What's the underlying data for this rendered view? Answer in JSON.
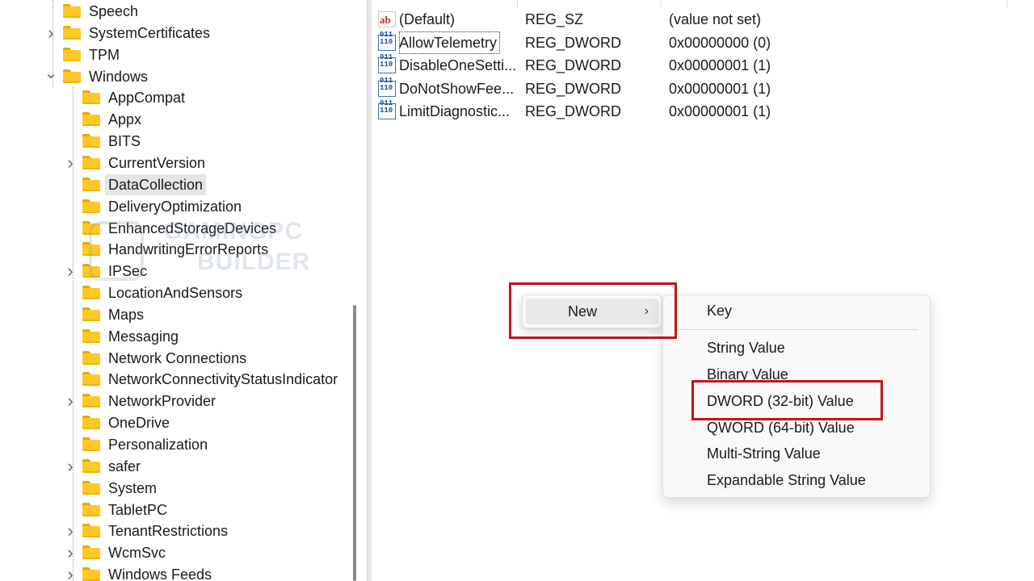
{
  "tree": {
    "nodes": [
      {
        "label": "Speech",
        "chevron": ""
      },
      {
        "label": "SystemCertificates",
        "chevron": "›"
      },
      {
        "label": "TPM",
        "chevron": ""
      },
      {
        "label": "Windows",
        "chevron": "⌄"
      },
      {
        "label": "AppCompat",
        "chevron": ""
      },
      {
        "label": "Appx",
        "chevron": ""
      },
      {
        "label": "BITS",
        "chevron": ""
      },
      {
        "label": "CurrentVersion",
        "chevron": "›"
      },
      {
        "label": "DataCollection",
        "chevron": "",
        "selected": true
      },
      {
        "label": "DeliveryOptimization",
        "chevron": ""
      },
      {
        "label": "EnhancedStorageDevices",
        "chevron": ""
      },
      {
        "label": "HandwritingErrorReports",
        "chevron": ""
      },
      {
        "label": "IPSec",
        "chevron": "›"
      },
      {
        "label": "LocationAndSensors",
        "chevron": ""
      },
      {
        "label": "Maps",
        "chevron": ""
      },
      {
        "label": "Messaging",
        "chevron": ""
      },
      {
        "label": "Network Connections",
        "chevron": ""
      },
      {
        "label": "NetworkConnectivityStatusIndicator",
        "chevron": ""
      },
      {
        "label": "NetworkProvider",
        "chevron": "›"
      },
      {
        "label": "OneDrive",
        "chevron": ""
      },
      {
        "label": "Personalization",
        "chevron": ""
      },
      {
        "label": "safer",
        "chevron": "›"
      },
      {
        "label": "System",
        "chevron": ""
      },
      {
        "label": "TabletPC",
        "chevron": ""
      },
      {
        "label": "TenantRestrictions",
        "chevron": "›"
      },
      {
        "label": "WcmSvc",
        "chevron": "›"
      },
      {
        "label": "Windows Feeds",
        "chevron": "›"
      }
    ]
  },
  "watermark": {
    "line1": "GAMINGPC",
    "line2": "BUILDER"
  },
  "values": {
    "rows": [
      {
        "icon": "string-value-icon",
        "name": "(Default)",
        "type": "REG_SZ",
        "data": "(value not set)"
      },
      {
        "icon": "dword-value-icon",
        "name": "AllowTelemetry",
        "type": "REG_DWORD",
        "data": "0x00000000 (0)"
      },
      {
        "icon": "dword-value-icon",
        "name": "DisableOneSetti...",
        "type": "REG_DWORD",
        "data": "0x00000001 (1)"
      },
      {
        "icon": "dword-value-icon",
        "name": "DoNotShowFee...",
        "type": "REG_DWORD",
        "data": "0x00000001 (1)"
      },
      {
        "icon": "dword-value-icon",
        "name": "LimitDiagnostic...",
        "type": "REG_DWORD",
        "data": "0x00000001 (1)"
      }
    ]
  },
  "context_menu": {
    "new_label": "New",
    "new_arrow": "›"
  },
  "submenu": {
    "key": "Key",
    "string_value": "String Value",
    "binary_value": "Binary Value",
    "dword_value": "DWORD (32-bit) Value",
    "qword_value": "QWORD (64-bit) Value",
    "multi_string_value": "Multi-String Value",
    "expandable_string_value": "Expandable String Value"
  },
  "colors": {
    "highlight_box": "#c0141c",
    "folder": "#ffc825",
    "selection": "#e5e5e5"
  }
}
